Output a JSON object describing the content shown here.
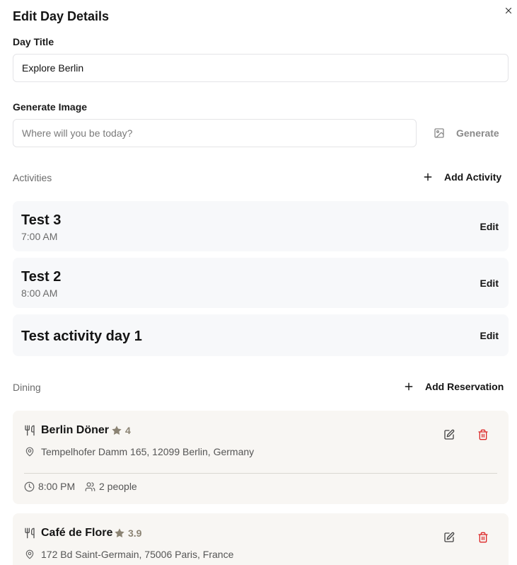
{
  "modal": {
    "title": "Edit Day Details"
  },
  "day_title": {
    "label": "Day Title",
    "value": "Explore Berlin"
  },
  "generate_image": {
    "label": "Generate Image",
    "placeholder": "Where will you be today?",
    "button_label": "Generate"
  },
  "activities": {
    "section_label": "Activities",
    "add_label": "Add Activity",
    "edit_label": "Edit",
    "items": [
      {
        "title": "Test 3",
        "time": "7:00 AM"
      },
      {
        "title": "Test 2",
        "time": "8:00 AM"
      },
      {
        "title": "Test activity day 1",
        "time": ""
      }
    ]
  },
  "dining": {
    "section_label": "Dining",
    "add_label": "Add Reservation",
    "items": [
      {
        "name": "Berlin Döner",
        "rating": "4",
        "address": "Tempelhofer Damm 165, 12099 Berlin, Germany",
        "time": "8:00 PM",
        "party": "2 people"
      },
      {
        "name": "Café de Flore",
        "rating": "3.9",
        "address": "172 Bd Saint-Germain, 75006 Paris, France"
      }
    ]
  },
  "colors": {
    "accent_text": "#141414",
    "muted_text": "#6b6b6b",
    "delete_red": "#dc2626",
    "rating_brown": "#8b8373",
    "activity_card_bg": "#f7f8fa",
    "dining_card_bg": "#f8f6f3"
  },
  "icons": {
    "close": "close-icon",
    "generate": "image-icon",
    "add": "plus-icon",
    "dining": "utensils-icon",
    "rating": "star-icon",
    "address": "map-pin-icon",
    "edit": "pencil-square-icon",
    "delete": "trash-icon",
    "time": "clock-icon",
    "party": "users-icon"
  }
}
